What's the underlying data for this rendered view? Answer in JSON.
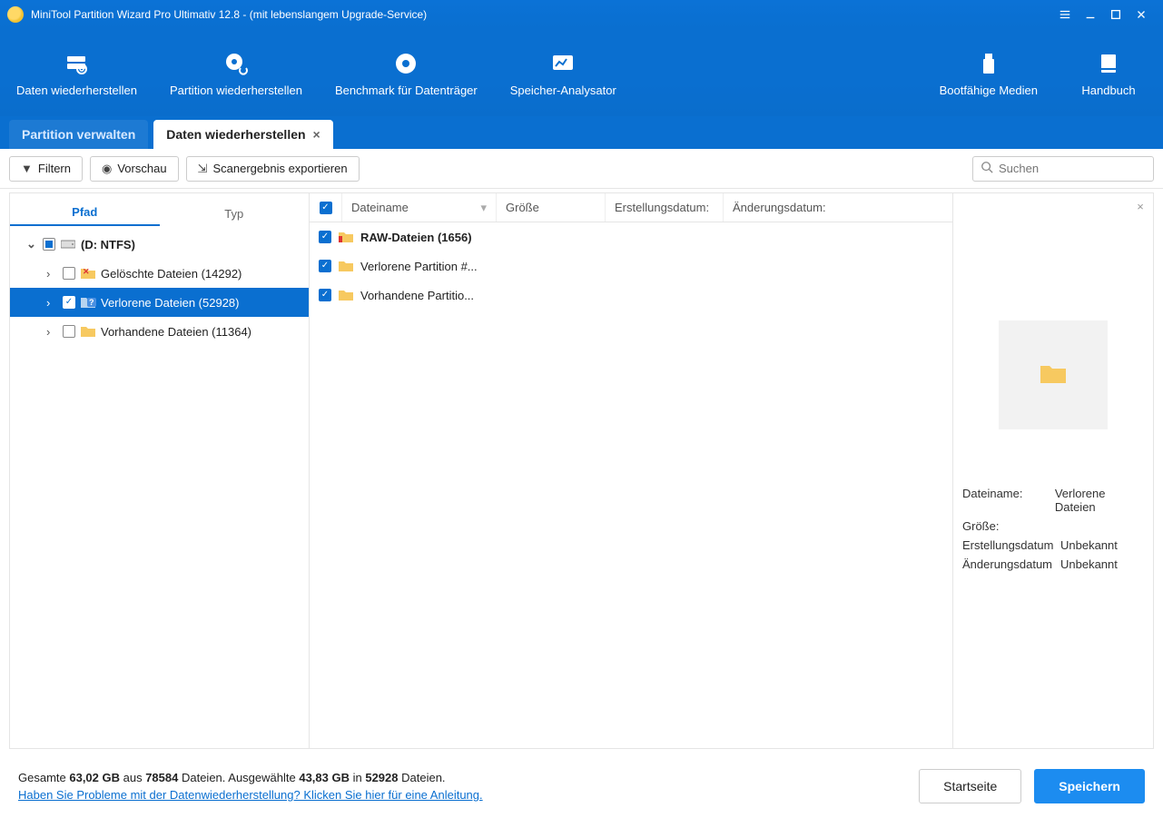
{
  "titlebar": {
    "title": "MiniTool Partition Wizard Pro Ultimativ 12.8 - (mit lebenslangem Upgrade-Service)"
  },
  "toolbar": {
    "data_recover": "Daten wiederherstellen",
    "partition_recover": "Partition wiederherstellen",
    "benchmark": "Benchmark für Datenträger",
    "space_analyzer": "Speicher-Analysator",
    "bootable": "Bootfähige Medien",
    "handbook": "Handbuch"
  },
  "tabs": {
    "manage": "Partition verwalten",
    "recover": "Daten wiederherstellen"
  },
  "subbar": {
    "filter": "Filtern",
    "preview": "Vorschau",
    "export": "Scanergebnis exportieren",
    "search_placeholder": "Suchen"
  },
  "left": {
    "tab_path": "Pfad",
    "tab_type": "Typ",
    "root": "(D: NTFS)",
    "deleted": "Gelöschte Dateien (14292)",
    "lost": "Verlorene Dateien (52928)",
    "existing": "Vorhandene Dateien (11364)"
  },
  "list": {
    "col_name": "Dateiname",
    "col_size": "Größe",
    "col_created": "Erstellungsdatum:",
    "col_modified": "Änderungsdatum:",
    "rows": {
      "raw": "RAW-Dateien (1656)",
      "lostpart": "Verlorene Partition #...",
      "exist": "Vorhandene Partitio..."
    }
  },
  "preview": {
    "label_name": "Dateiname:",
    "value_name": "Verlorene Dateien",
    "label_size": "Größe:",
    "value_size": "",
    "label_created": "Erstellungsdatum",
    "value_created": "Unbekannt",
    "label_modified": "Änderungsdatum",
    "value_modified": "Unbekannt"
  },
  "footer": {
    "stats_prefix": "Gesamte ",
    "total_size": "63,02 GB",
    "stats_mid1": " aus ",
    "total_files": "78584",
    "stats_mid2": " Dateien.  Ausgewählte ",
    "sel_size": "43,83 GB",
    "stats_mid3": " in ",
    "sel_files": "52928",
    "stats_suffix": " Dateien.",
    "help": "Haben Sie Probleme mit der Datenwiederherstellung? Klicken Sie hier für eine Anleitung.",
    "home": "Startseite",
    "save": "Speichern"
  }
}
